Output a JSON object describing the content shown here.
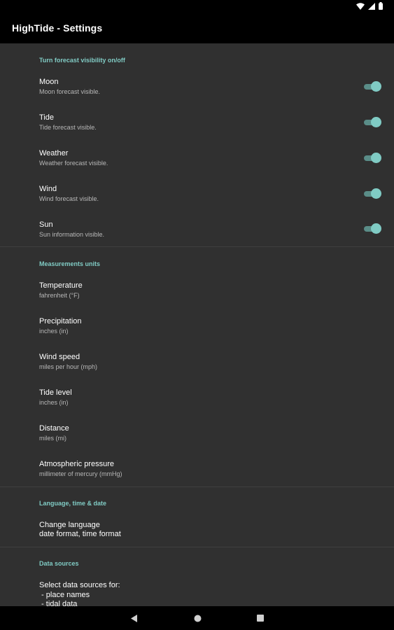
{
  "app": {
    "title": "HighTide - Settings"
  },
  "sections": {
    "visibility": {
      "header": "Turn forecast visibility on/off",
      "items": [
        {
          "title": "Moon",
          "subtitle": "Moon forecast visible.",
          "enabled": true
        },
        {
          "title": "Tide",
          "subtitle": "Tide forecast visible.",
          "enabled": true
        },
        {
          "title": "Weather",
          "subtitle": "Weather forecast visible.",
          "enabled": true
        },
        {
          "title": "Wind",
          "subtitle": "Wind forecast visible.",
          "enabled": true
        },
        {
          "title": "Sun",
          "subtitle": "Sun information visible.",
          "enabled": true
        }
      ]
    },
    "units": {
      "header": "Measurements units",
      "items": [
        {
          "title": "Temperature",
          "subtitle": "fahrenheit (°F)"
        },
        {
          "title": "Precipitation",
          "subtitle": "inches (in)"
        },
        {
          "title": "Wind speed",
          "subtitle": "miles per hour (mph)"
        },
        {
          "title": "Tide level",
          "subtitle": "inches (in)"
        },
        {
          "title": "Distance",
          "subtitle": "miles (mi)"
        },
        {
          "title": "Atmospheric pressure",
          "subtitle": "millimeter of mercury (mmHg)"
        }
      ]
    },
    "language": {
      "header": "Language, time & date",
      "line1": "Change language",
      "line2": "date format, time format"
    },
    "data_sources": {
      "header": "Data sources",
      "line1": "Select data sources for:",
      "line2": " - place names",
      "line3": " - tidal data"
    }
  },
  "colors": {
    "accent": "#80cbc4",
    "background": "#303030",
    "bar": "#000000"
  },
  "icons": {
    "status": [
      "wifi-icon",
      "signal-icon",
      "battery-icon"
    ],
    "nav": [
      "back-icon",
      "home-icon",
      "recents-icon"
    ]
  }
}
